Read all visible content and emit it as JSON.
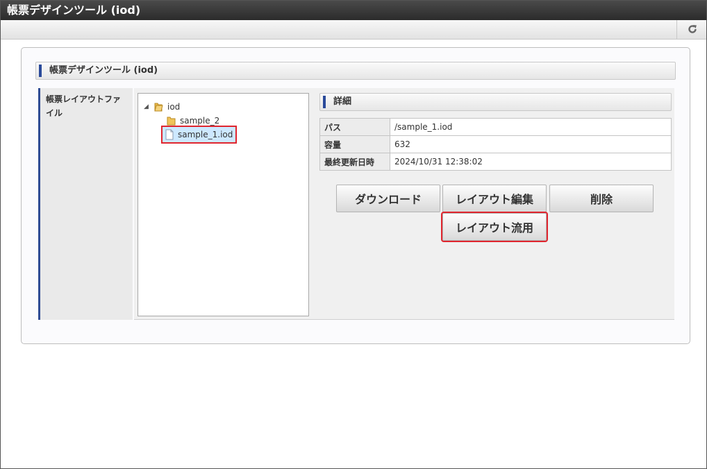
{
  "window": {
    "title": "帳票デザインツール (iod)"
  },
  "toolbar": {
    "refresh_icon": "refresh-icon"
  },
  "panel": {
    "header": "帳票デザインツール (iod)"
  },
  "form": {
    "label": "帳票レイアウトファイル"
  },
  "tree": {
    "root": {
      "label": "iod",
      "expanded": true
    },
    "children": [
      {
        "label": "sample_2",
        "type": "folder"
      },
      {
        "label": "sample_1.iod",
        "type": "file",
        "selected": true
      }
    ]
  },
  "detail": {
    "header": "詳細",
    "rows": [
      {
        "key": "パス",
        "value": "/sample_1.iod"
      },
      {
        "key": "容量",
        "value": "632"
      },
      {
        "key": "最終更新日時",
        "value": "2024/10/31 12:38:02"
      }
    ]
  },
  "buttons": {
    "download": "ダウンロード",
    "edit_layout": "レイアウト編集",
    "delete": "削除",
    "reuse_layout": "レイアウト流用"
  },
  "colors": {
    "accent": "#2a4a9a",
    "highlight": "#e0252e",
    "selection": "#cde8ff"
  }
}
